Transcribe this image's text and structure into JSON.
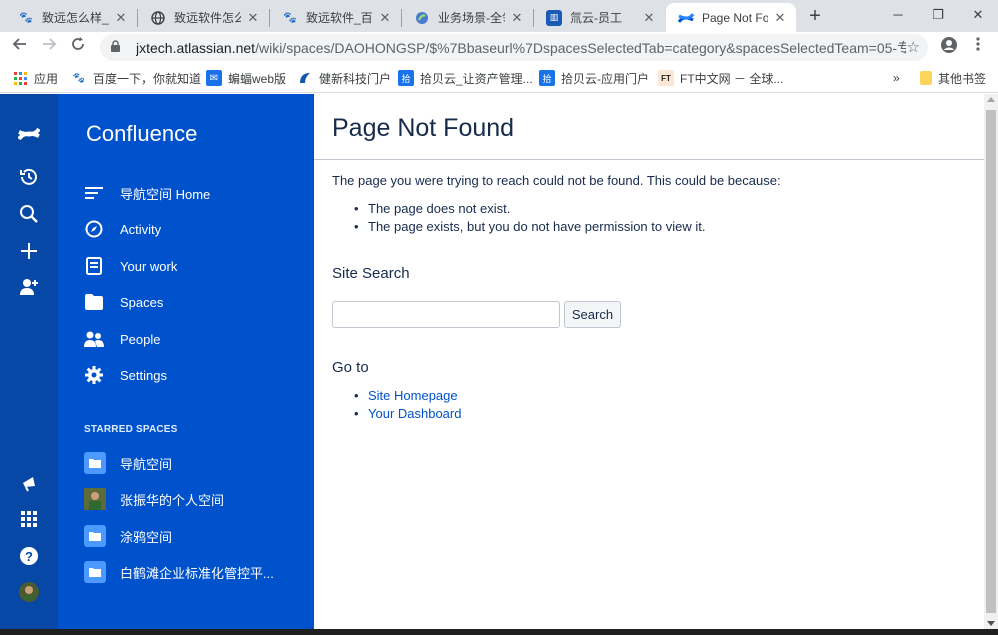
{
  "browser": {
    "tabs": [
      {
        "title": "致远怎么样_百度搜索",
        "icon": "baidu-paw-icon"
      },
      {
        "title": "致远软件怎么样",
        "icon": "globe-icon"
      },
      {
        "title": "致远软件_百度搜索",
        "icon": "baidu-paw-icon"
      },
      {
        "title": "业务场景-全领域",
        "icon": "seeyon-icon"
      },
      {
        "title": "氚云-员工",
        "icon": "h3yun-icon"
      },
      {
        "title": "Page Not Found",
        "icon": "confluence-icon"
      }
    ],
    "url_host": "jxtech.atlassian.net",
    "url_path": "/wiki/spaces/DAOHONGSP/$%7Bbaseurl%7DspacesSelectedTab=category&spacesSelectedTeam=05-专...",
    "bookmarks": [
      {
        "label": "应用",
        "icon": "apps-grid-icon"
      },
      {
        "label": "百度一下，你就知道",
        "icon": "baidu-paw-icon"
      },
      {
        "label": "蝙蝠web版",
        "icon": "bat-icon"
      },
      {
        "label": "健新科技门户",
        "icon": "jianxin-icon"
      },
      {
        "label": "拾贝云_让资产管理...",
        "icon": "shibei-icon"
      },
      {
        "label": "拾贝云-应用门户",
        "icon": "shibei-icon"
      },
      {
        "label": "FT中文网 － 全球...",
        "icon": "ft-icon"
      }
    ],
    "bookmarks_overflow": "»",
    "other_bookmarks": "其他书签"
  },
  "sidebar": {
    "app_title": "Confluence",
    "nav_items": [
      {
        "label": "导航空间 Home",
        "icon": "overview-lines-icon"
      },
      {
        "label": "Activity",
        "icon": "compass-icon"
      },
      {
        "label": "Your work",
        "icon": "document-icon"
      },
      {
        "label": "Spaces",
        "icon": "folder-icon"
      },
      {
        "label": "People",
        "icon": "people-icon"
      },
      {
        "label": "Settings",
        "icon": "gear-icon"
      }
    ],
    "starred_heading": "STARRED SPACES",
    "starred_spaces": [
      {
        "label": "导航空间",
        "icon": "space-folder-icon"
      },
      {
        "label": "张振华的个人空间",
        "icon": "user-avatar-icon"
      },
      {
        "label": "涂鸦空间",
        "icon": "space-folder-icon"
      },
      {
        "label": "白鹤滩企业标准化管控平...",
        "icon": "space-folder-icon"
      }
    ]
  },
  "main": {
    "title": "Page Not Found",
    "message": "The page you were trying to reach could not be found. This could be because:",
    "reasons": [
      "The page does not exist.",
      "The page exists, but you do not have permission to view it."
    ],
    "search_heading": "Site Search",
    "search_value": "",
    "search_button": "Search",
    "goto_heading": "Go to",
    "goto_links": [
      "Site Homepage",
      "Your Dashboard"
    ]
  },
  "colors": {
    "global_nav": "#0747a6",
    "space_nav": "#0052cc",
    "link": "#0052cc",
    "text": "#172b4d"
  }
}
